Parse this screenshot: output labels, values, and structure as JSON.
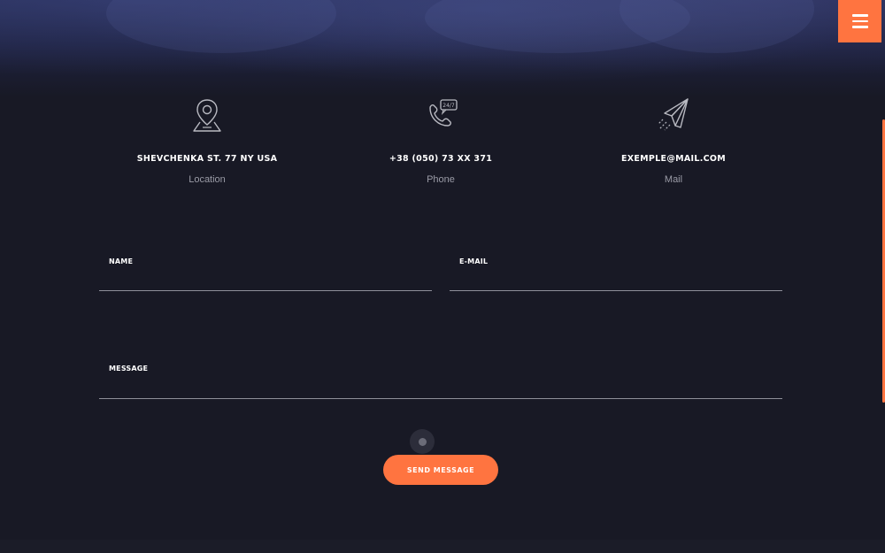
{
  "menu": {
    "icon": "hamburger-icon"
  },
  "contact_info": [
    {
      "icon": "map-pin-icon",
      "title": "SHEVCHENKA ST. 77 NY USA",
      "label": "Location"
    },
    {
      "icon": "phone-24-7-icon",
      "title": "+38 (050) 73 XX 371",
      "label": "Phone"
    },
    {
      "icon": "paper-plane-icon",
      "title": "EXEMPLE@MAIL.COM",
      "label": "Mail"
    }
  ],
  "form": {
    "name_label": "NAME",
    "email_label": "E-MAIL",
    "message_label": "MESSAGE",
    "name_value": "",
    "email_value": "",
    "message_value": "",
    "submit_label": "SEND MESSAGE"
  },
  "colors": {
    "accent": "#ff7440",
    "background": "#181925",
    "muted_text": "#9a9ba6"
  }
}
